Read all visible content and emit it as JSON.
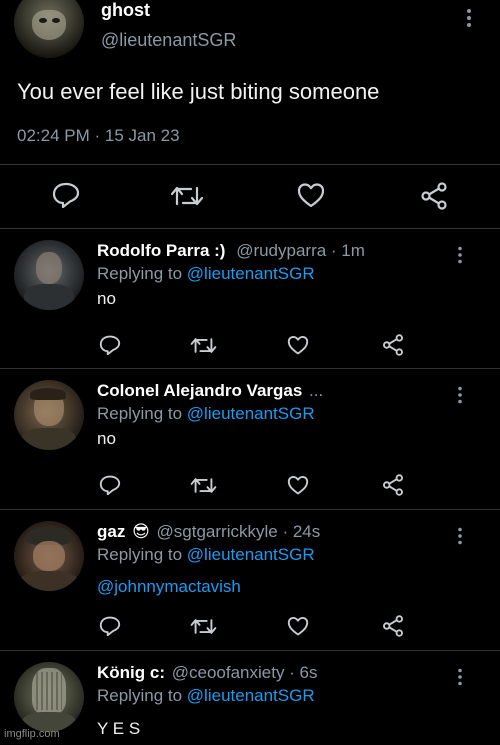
{
  "main_tweet": {
    "display_name": "ghost",
    "handle": "@lieutenantSGR",
    "text": "You ever feel like just biting someone",
    "timestamp": "02:24 PM · 15 Jan 23",
    "actions": [
      "reply-icon",
      "retweet-icon",
      "like-icon",
      "share-icon"
    ]
  },
  "replies": [
    {
      "display_name": "Rodolfo Parra :)",
      "meta": "@rudyparra · 1m",
      "replying_prefix": "Replying to",
      "replying_to": "@lieutenantSGR",
      "text": "no"
    },
    {
      "display_name": "Colonel Alejandro Vargas",
      "meta": "...",
      "replying_prefix": "Replying to",
      "replying_to": "@lieutenantSGR",
      "text": "no"
    },
    {
      "display_name": "gaz",
      "emoji": "😎",
      "meta": "@sgtgarrickkyle · 24s",
      "replying_prefix": "Replying to",
      "replying_to": "@lieutenantSGR",
      "text": "@johnnymactavish"
    },
    {
      "display_name": "König c:",
      "meta": "@ceoofanxiety · 6s",
      "replying_prefix": "Replying to",
      "replying_to": "@lieutenantSGR",
      "text": "Y E S"
    }
  ],
  "watermark": "imgflip.com",
  "colors": {
    "background": "#000000",
    "secondary_text": "#8b98a5",
    "link": "#1d9bf0",
    "divider": "#2f3336"
  }
}
